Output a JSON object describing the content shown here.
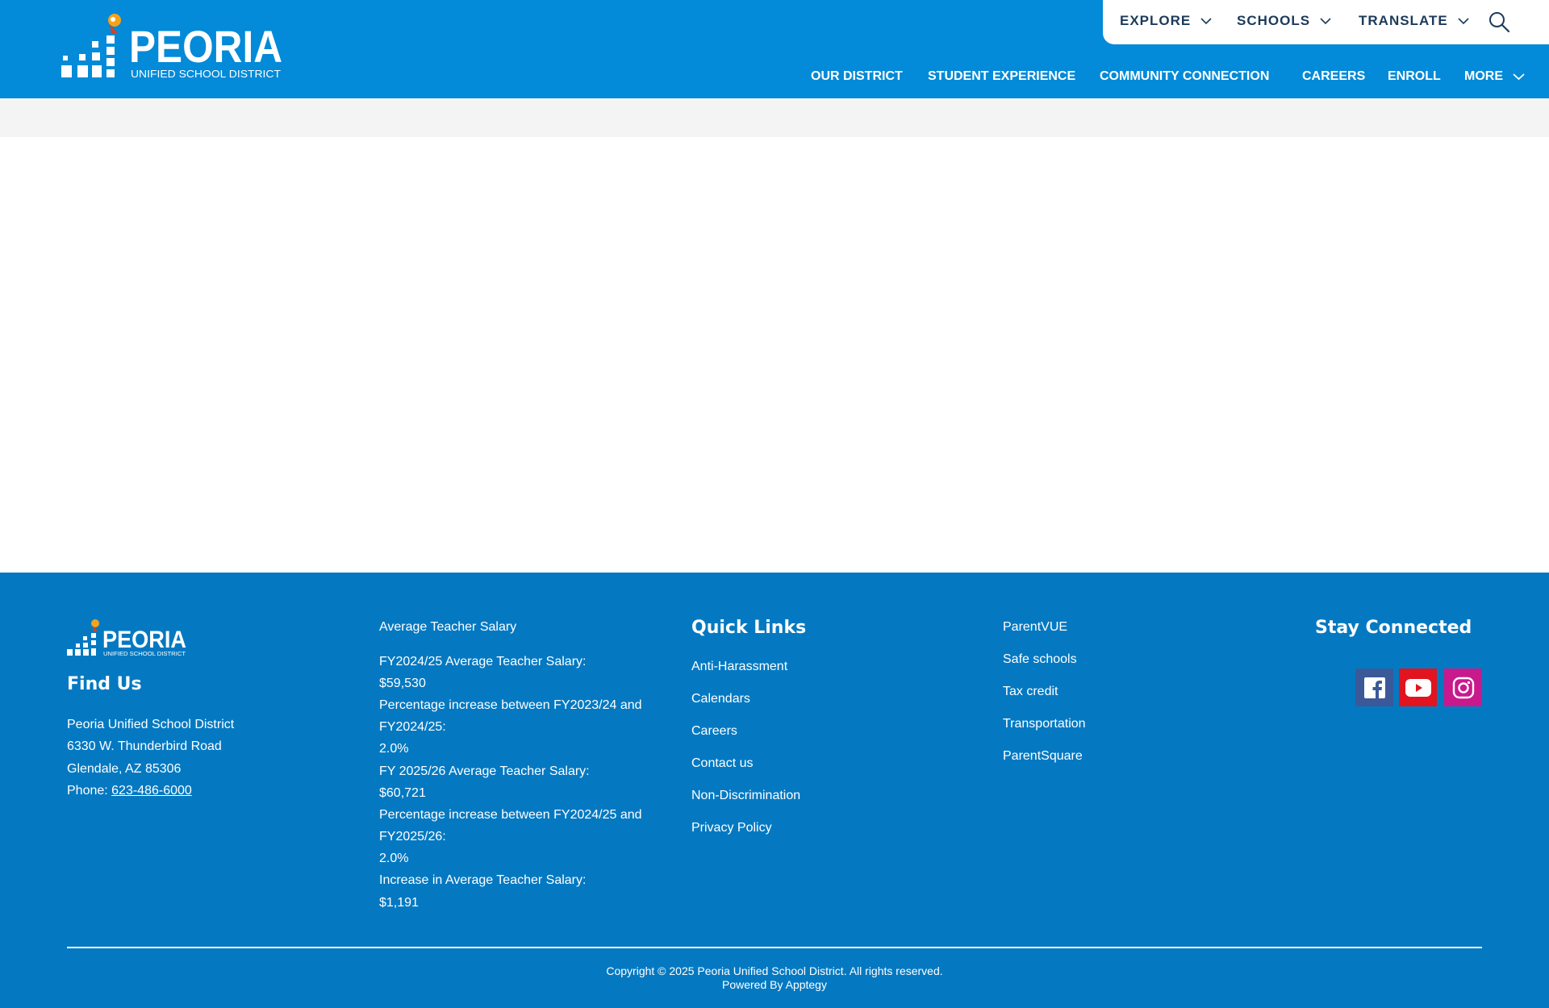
{
  "brand": {
    "logo_alt": "Peoria Unified School District logo",
    "name": "PEORIA",
    "subtitle": "UNIFIED SCHOOL DISTRICT",
    "primary_color": "#038ad8",
    "footer_color": "#0479c2",
    "utility_text_color": "#1c3a5a"
  },
  "utility_nav": {
    "explore": "EXPLORE",
    "schools": "SCHOOLS",
    "translate": "TRANSLATE",
    "search_icon": "search-icon"
  },
  "main_nav": {
    "items": [
      "OUR DISTRICT",
      "STUDENT EXPERIENCE",
      "COMMUNITY CONNECTION",
      "CAREERS",
      "ENROLL"
    ],
    "more": "MORE"
  },
  "footer": {
    "find_us": {
      "heading": "Find Us",
      "org": "Peoria Unified School District",
      "street": "6330 W. Thunderbird Road",
      "city": "Glendale, AZ 85306",
      "phone_label": "Phone: ",
      "phone": "623-486-6000"
    },
    "salary": {
      "title": "Average Teacher Salary",
      "lines": [
        "FY2024/25 Average Teacher Salary:",
        "$59,530",
        "Percentage increase between FY2023/24 and",
        "FY2024/25:",
        "2.0%",
        "FY 2025/26 Average Teacher Salary:",
        "$60,721",
        "Percentage increase between FY2024/25 and",
        "FY2025/26:",
        "2.0%",
        "Increase in Average Teacher Salary:",
        "$1,191"
      ]
    },
    "quick_links": {
      "heading": "Quick Links",
      "items": [
        "Anti-Harassment",
        "Calendars",
        "Careers",
        "Contact us",
        "Non-Discrimination",
        "Privacy Policy"
      ]
    },
    "more_links": [
      "ParentVUE",
      "Safe schools",
      "Tax credit",
      "Transportation",
      "ParentSquare"
    ],
    "stay_connected": {
      "heading": "Stay Connected",
      "icons": [
        "facebook-icon",
        "youtube-icon",
        "instagram-icon"
      ],
      "facebook_color": "#3b5998",
      "youtube_color": "#e1141f",
      "instagram_color": "#c81a8c"
    },
    "copyright": "Copyright © 2025 Peoria Unified School District. All rights reserved.",
    "powered_by": "Powered By Apptegy"
  }
}
